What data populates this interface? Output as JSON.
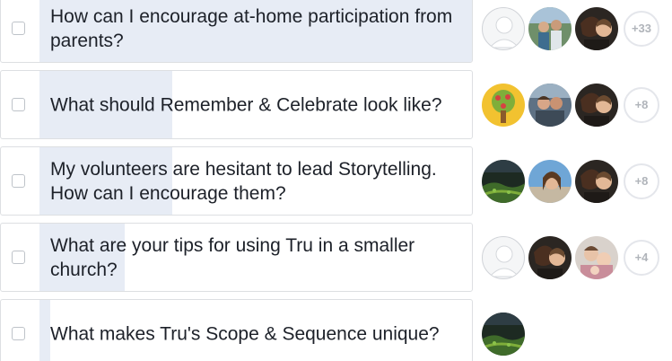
{
  "poll": {
    "options": [
      {
        "text": "How can I encourage at-home participation from parents?",
        "vote_share": 1.0,
        "voters": [
          "default-avatar-icon",
          "family-photo",
          "couple-photo"
        ],
        "more": "+33"
      },
      {
        "text": "What should Remember & Celebrate look like?",
        "vote_share": 0.32,
        "voters": [
          "tree-illustration",
          "couple-photo",
          "couple-photo"
        ],
        "more": "+8"
      },
      {
        "text": "My volunteers are hesitant to lead Storytelling. How can I encourage them?",
        "vote_share": 0.32,
        "voters": [
          "landscape-photo",
          "woman-photo",
          "couple-photo"
        ],
        "more": "+8"
      },
      {
        "text": "What are your tips for using Tru in a smaller church?",
        "vote_share": 0.2,
        "voters": [
          "default-avatar-icon",
          "couple-photo",
          "family-photo"
        ],
        "more": "+4"
      },
      {
        "text": "What makes Tru's Scope & Sequence unique?",
        "vote_share": 0.04,
        "voters": [
          "landscape-photo"
        ],
        "more": ""
      }
    ]
  },
  "colors": {
    "fill": "#e7ecf5",
    "border": "#dddfe2",
    "text": "#1d2129",
    "badge_text": "#b0b4ba"
  }
}
